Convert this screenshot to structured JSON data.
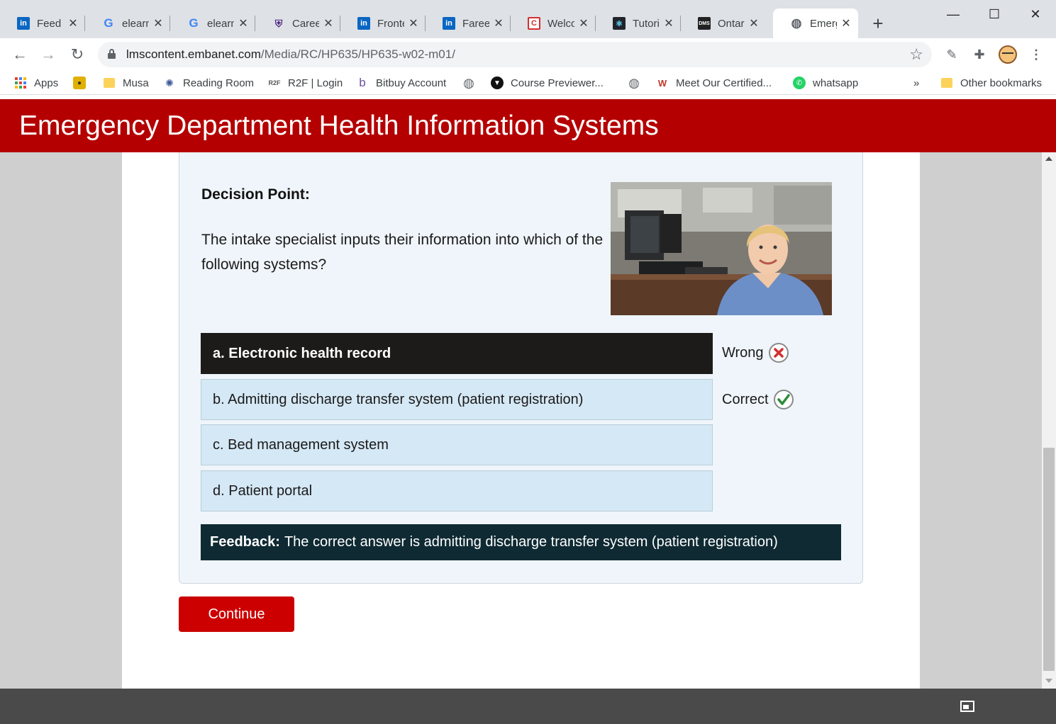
{
  "browser": {
    "tabs": [
      {
        "title": "Feed |",
        "icon": "linkedin-icon"
      },
      {
        "title": "elearn",
        "icon": "google-icon"
      },
      {
        "title": "elearn",
        "icon": "google-icon"
      },
      {
        "title": "Career",
        "icon": "western-crest-icon"
      },
      {
        "title": "Fronte",
        "icon": "linkedin-icon"
      },
      {
        "title": "Fareed",
        "icon": "linkedin-icon"
      },
      {
        "title": "Welco",
        "icon": "c-app-icon"
      },
      {
        "title": "Tutori",
        "icon": "react-icon"
      },
      {
        "title": "Ontar",
        "icon": "dms-icon"
      },
      {
        "title": "Emerg",
        "icon": "globe-icon",
        "active": true
      }
    ],
    "url_host": "lmscontent.embanet.com",
    "url_path": "/Media/RC/HP635/HP635-w02-m01/",
    "bookmarks": [
      {
        "label": "Apps",
        "icon": "apps-grid-icon"
      },
      {
        "label": "",
        "icon": "custom-site-icon"
      },
      {
        "label": "Musa",
        "icon": "folder-icon"
      },
      {
        "label": "Reading Room",
        "icon": "reading-room-icon"
      },
      {
        "label": "R2F | Login",
        "icon": "r2f-icon"
      },
      {
        "label": "Bitbuy Account",
        "icon": "bitbuy-icon"
      },
      {
        "label": "",
        "icon": "globe-icon"
      },
      {
        "label": "Course Previewer...",
        "icon": "course-previewer-icon"
      },
      {
        "label": "",
        "icon": "globe-icon"
      },
      {
        "label": "Meet Our Certified...",
        "icon": "certified-icon"
      },
      {
        "label": "whatsapp",
        "icon": "whatsapp-icon"
      },
      {
        "label": "Other bookmarks",
        "icon": "folder-icon"
      }
    ],
    "more_bookmarks": "»"
  },
  "page": {
    "banner_title": "Emergency Department Health Information Systems",
    "decision_title": "Decision Point:",
    "question": "The intake specialist inputs their information into which of the following systems?",
    "options": [
      {
        "label": "a. Electronic health record",
        "selected": true,
        "result": "Wrong",
        "result_icon": "wrong-x-icon"
      },
      {
        "label": "b. Admitting discharge transfer system (patient registration)",
        "selected": false,
        "result": "Correct",
        "result_icon": "correct-check-icon"
      },
      {
        "label": "c. Bed management system",
        "selected": false
      },
      {
        "label": "d. Patient portal",
        "selected": false
      }
    ],
    "feedback_label": "Feedback:",
    "feedback_text": "The correct answer is admitting discharge transfer system (patient registration)",
    "continue_label": "Continue"
  },
  "colors": {
    "banner": "#b40000",
    "continue_button": "#cc0000",
    "selected_option": "#1d1b1a",
    "option_bg": "#d5e8f5",
    "feedback_bg": "#0f2a33",
    "wrong": "#d32f2f",
    "correct": "#2e8b3a"
  }
}
